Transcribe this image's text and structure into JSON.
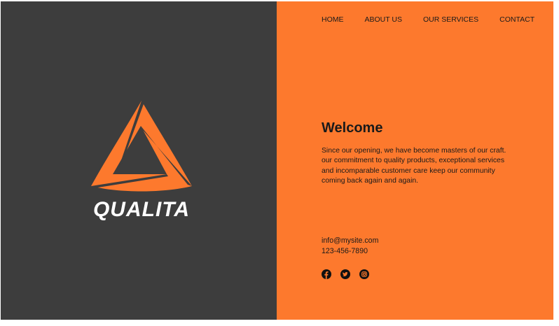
{
  "colors": {
    "left_panel": "#3d3d3d",
    "accent": "#fd792d",
    "text_dark": "#1a1a1a",
    "logo_text": "#ffffff"
  },
  "brand": {
    "logo_icon": "triangle-logo-icon",
    "name": "QUALITA"
  },
  "nav": {
    "items": [
      {
        "label": "HOME"
      },
      {
        "label": "ABOUT US"
      },
      {
        "label": "OUR SERVICES"
      },
      {
        "label": "CONTACT"
      }
    ]
  },
  "welcome": {
    "title": "Welcome",
    "body_lines": [
      "Since our opening, we have become masters of our craft.",
      "our commitment to quality products, exceptional services",
      "and incomparable customer care keep our community",
      "coming back again and again."
    ]
  },
  "contact": {
    "email": "info@mysite.com",
    "phone": "123-456-7890"
  },
  "socials": [
    {
      "icon": "facebook-icon"
    },
    {
      "icon": "twitter-icon"
    },
    {
      "icon": "instagram-icon"
    }
  ]
}
